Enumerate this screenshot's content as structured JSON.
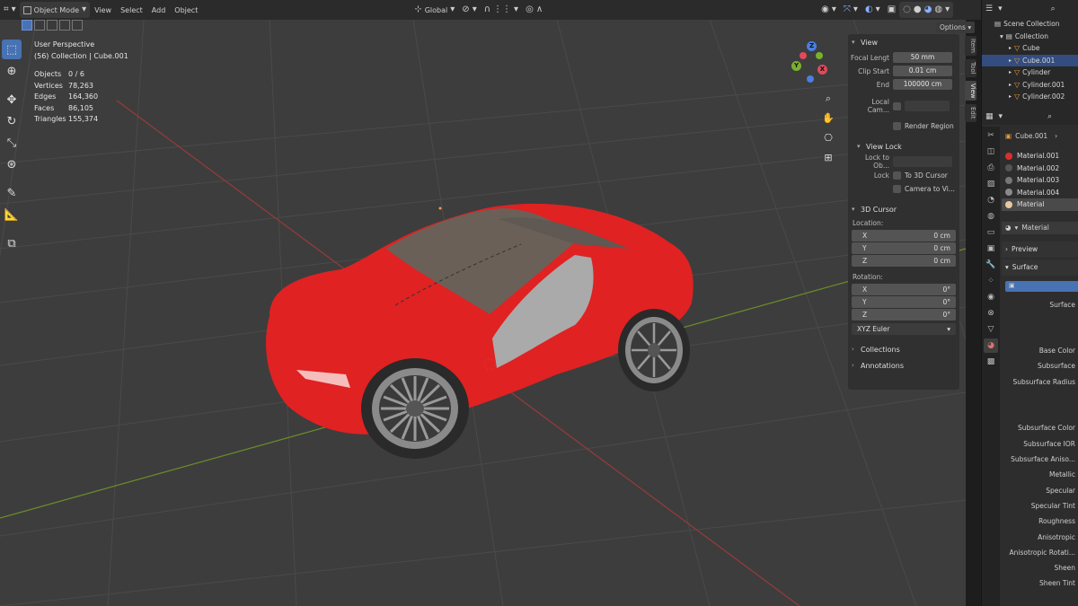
{
  "header": {
    "mode": "Object Mode",
    "menu": [
      "View",
      "Select",
      "Add",
      "Object"
    ],
    "orientation": "Global",
    "options_label": "Options"
  },
  "viewport": {
    "perspective": "User Perspective",
    "collection_info": "(56) Collection | Cube.001",
    "stats": [
      {
        "label": "Objects",
        "value": "0 / 6"
      },
      {
        "label": "Vertices",
        "value": "78,263"
      },
      {
        "label": "Edges",
        "value": "164,360"
      },
      {
        "label": "Faces",
        "value": "86,105"
      },
      {
        "label": "Triangles",
        "value": "155,374"
      }
    ],
    "gizmo_labels": {
      "x": "X",
      "y": "Y",
      "z": "Z"
    }
  },
  "npanel": {
    "view_title": "View",
    "focal_label": "Focal Lengt",
    "focal_value": "50 mm",
    "clip_start_label": "Clip Start",
    "clip_start_value": "0.01 cm",
    "end_label": "End",
    "end_value": "100000 cm",
    "local_camera_label": "Local Cam...",
    "render_region_label": "Render Region",
    "view_lock_title": "View Lock",
    "lock_to_obj_label": "Lock to Ob...",
    "lock_label": "Lock",
    "to_3d_cursor": "To 3D Cursor",
    "camera_to_view": "Camera to Vi...",
    "cursor_title": "3D Cursor",
    "location_label": "Location:",
    "location": [
      {
        "axis": "X",
        "value": "0 cm"
      },
      {
        "axis": "Y",
        "value": "0 cm"
      },
      {
        "axis": "Z",
        "value": "0 cm"
      }
    ],
    "rotation_label": "Rotation:",
    "rotation": [
      {
        "axis": "X",
        "value": "0°"
      },
      {
        "axis": "Y",
        "value": "0°"
      },
      {
        "axis": "Z",
        "value": "0°"
      }
    ],
    "rotation_mode": "XYZ Euler",
    "collections_title": "Collections",
    "annotations_title": "Annotations"
  },
  "vtabs": [
    "Item",
    "Tool",
    "View",
    "Edit"
  ],
  "outliner": {
    "scene_collection": "Scene Collection",
    "collection": "Collection",
    "items": [
      "Cube",
      "Cube.001",
      "Cylinder",
      "Cylinder.001",
      "Cylinder.002"
    ]
  },
  "properties": {
    "object_name": "Cube.001",
    "materials": [
      {
        "name": "Material.001",
        "color": "#d63030"
      },
      {
        "name": "Material.002",
        "color": "#555555"
      },
      {
        "name": "Material.003",
        "color": "#777777"
      },
      {
        "name": "Material.004",
        "color": "#8a8a8a"
      },
      {
        "name": "Material",
        "color": "#e8c8a0"
      }
    ],
    "active_material": "Material",
    "preview_label": "Preview",
    "surface_label": "Surface",
    "surface_field": "Surface",
    "bsdf_fields": [
      "Base Color",
      "Subsurface",
      "Subsurface Radius",
      "",
      "",
      "Subsurface Color",
      "Subsurface IOR",
      "Subsurface Aniso...",
      "Metallic",
      "Specular",
      "Specular Tint",
      "Roughness",
      "Anisotropic",
      "Anisotropic Rotati...",
      "Sheen",
      "Sheen Tint"
    ]
  },
  "colors": {
    "accent": "#4772b3",
    "car_red": "#e02222",
    "grid_green": "#6a8f2a",
    "grid_red": "#9a3a3a"
  }
}
